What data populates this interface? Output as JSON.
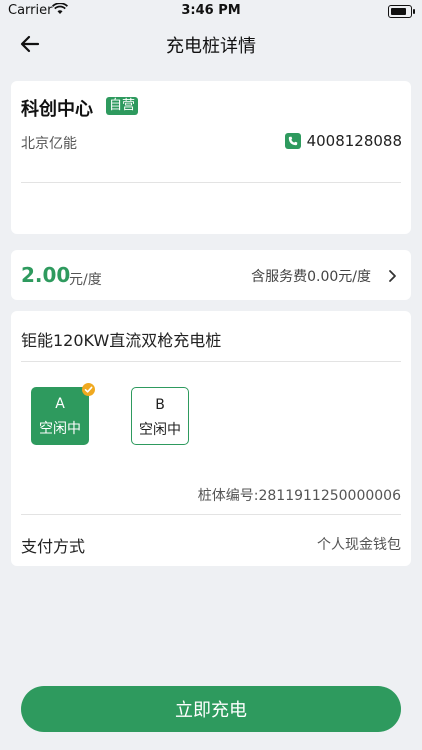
{
  "status_bar": {
    "carrier": "Carrier",
    "time": "3:46 PM"
  },
  "nav": {
    "title": "充电桩详情"
  },
  "station": {
    "name": "科创中心",
    "badge": "自营",
    "operator": "北京亿能",
    "phone": "4008128088"
  },
  "price": {
    "value": "2.00",
    "unit": "元/度",
    "service_fee": "含服务费0.00元/度"
  },
  "pile": {
    "name": "钜能120KW直流双枪充电桩",
    "guns": [
      {
        "letter": "A",
        "status": "空闲中",
        "selected": true
      },
      {
        "letter": "B",
        "status": "空闲中",
        "selected": false
      }
    ],
    "number": "桩体编号:2811911250000006"
  },
  "payment": {
    "label": "支付方式",
    "value": "个人现金钱包"
  },
  "action": {
    "label": "立即充电"
  },
  "colors": {
    "accent": "#2e9a5e",
    "check": "#f0a920",
    "background": "#eef0f3"
  }
}
